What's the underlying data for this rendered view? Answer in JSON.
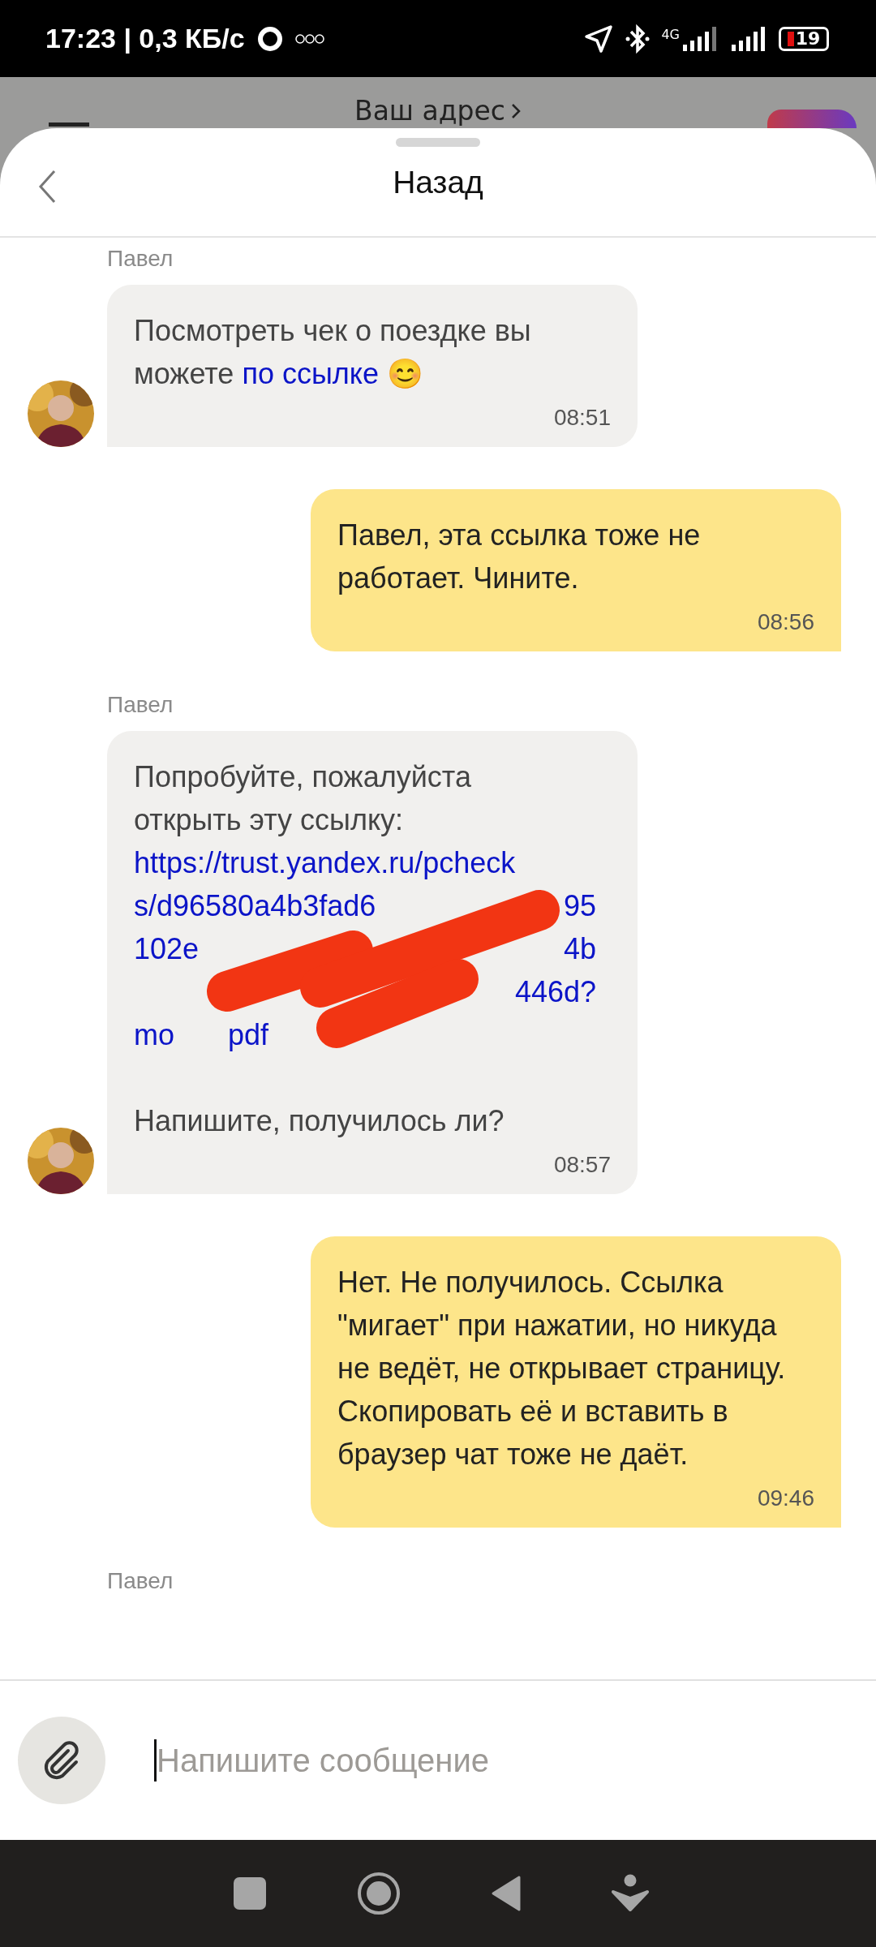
{
  "status_bar": {
    "time_speed": "17:23 | 0,3 КБ/с",
    "network": "4G",
    "battery": "19"
  },
  "background": {
    "address": "Ваш адрес"
  },
  "header": {
    "title": "Назад"
  },
  "messages": [
    {
      "kind": "incoming",
      "sender": "Павел",
      "time": "08:51",
      "paragraphs": [
        {
          "kind": "text",
          "segments": [
            {
              "text": "Посмотреть чек о поездке вы можете ",
              "kind": "text"
            },
            {
              "text": "по ссылке",
              "kind": "link"
            },
            {
              "text": " 😊",
              "kind": "text"
            }
          ]
        }
      ]
    },
    {
      "kind": "outgoing",
      "time": "08:56",
      "paragraphs": [
        {
          "kind": "text",
          "segments": [
            {
              "text": "Павел, эта ссылка тоже не работает. Чините.",
              "kind": "text"
            }
          ]
        }
      ]
    },
    {
      "kind": "incoming",
      "sender": "Павел",
      "time": "08:57",
      "paragraphs": [
        {
          "kind": "text",
          "segments": [
            {
              "text": "Попробуйте, пожалуйста открыть эту ссылку:",
              "kind": "text"
            }
          ]
        },
        {
          "kind": "link",
          "redacted": true,
          "lines": [
            {
              "kind": "left",
              "parts": [
                "https://trust.yandex.ru/pcheck"
              ]
            },
            {
              "kind": "split",
              "parts": [
                "s/d96580a4b3fad6",
                "95"
              ]
            },
            {
              "kind": "split",
              "parts": [
                "102e",
                "4b"
              ]
            },
            {
              "kind": "right",
              "parts": [
                "446d?"
              ]
            },
            {
              "kind": "tight",
              "parts": [
                "mo",
                "pdf"
              ]
            }
          ]
        },
        {
          "kind": "text",
          "segments": [
            {
              "text": "Напишите, получилось ли?",
              "kind": "text"
            }
          ]
        }
      ]
    },
    {
      "kind": "outgoing",
      "time": "09:46",
      "paragraphs": [
        {
          "kind": "text",
          "segments": [
            {
              "text": "Нет. Не получилось. Ссылка \"мигает\" при нажатии, но никуда не ведёт, не открывает страницу. Скопировать её и вставить в браузер чат тоже не даёт.",
              "kind": "text"
            }
          ]
        }
      ]
    },
    {
      "kind": "label",
      "sender": "Павел"
    }
  ],
  "composer": {
    "placeholder": "Напишите сообщение"
  }
}
